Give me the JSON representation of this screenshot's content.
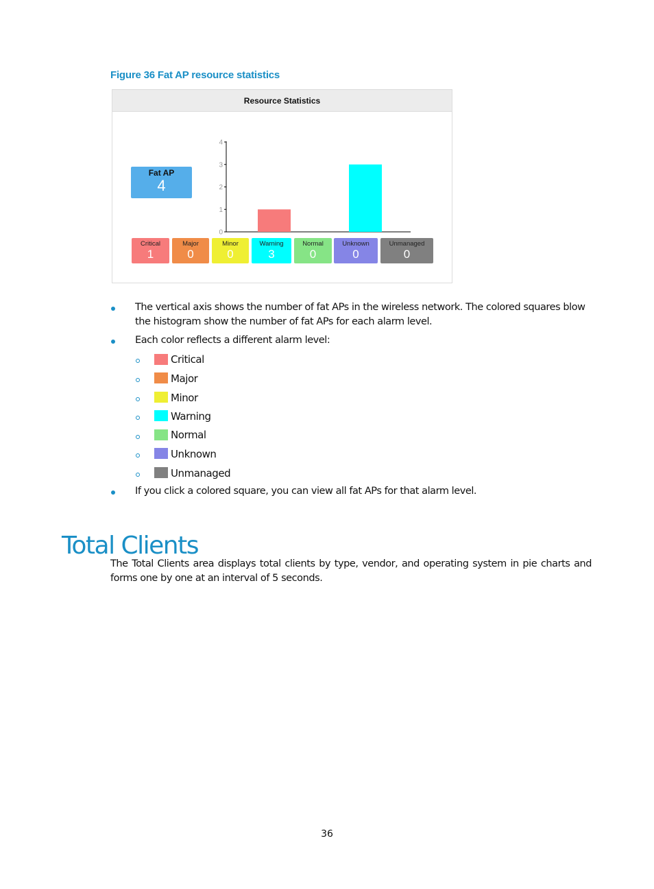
{
  "figure": {
    "caption": "Figure 36 Fat AP resource statistics",
    "panel_title": "Resource Statistics",
    "fat_ap": {
      "label": "Fat AP",
      "value": "4",
      "color": "#55aeea"
    },
    "levels": [
      {
        "name": "Critical",
        "value": "1",
        "color": "#f77b7b"
      },
      {
        "name": "Major",
        "value": "0",
        "color": "#f08c48"
      },
      {
        "name": "Minor",
        "value": "0",
        "color": "#efef33"
      },
      {
        "name": "Warning",
        "value": "3",
        "color": "#00ffff"
      },
      {
        "name": "Normal",
        "value": "0",
        "color": "#86e486"
      },
      {
        "name": "Unknown",
        "value": "0",
        "color": "#8585e6"
      },
      {
        "name": "Unmanaged",
        "value": "0",
        "color": "#808080"
      }
    ]
  },
  "chart_data": {
    "type": "bar",
    "title": "",
    "xlabel": "",
    "ylabel": "",
    "categories": [
      "Critical",
      "Warning"
    ],
    "values": [
      1,
      3
    ],
    "colors": [
      "#f77b7b",
      "#00ffff"
    ],
    "yticks": [
      "0",
      "1",
      "2",
      "3",
      "4"
    ],
    "ylim": [
      0,
      4
    ],
    "grid": false,
    "legend": "none"
  },
  "bullets": [
    "The vertical axis shows the number of fat APs in the wireless network. The colored squares blow the histogram show the number of fat APs for each alarm level.",
    "Each color reflects a different alarm level:",
    "If you click a colored square, you can view all fat APs for that alarm level."
  ],
  "alarm_levels": [
    "Critical",
    "Major",
    "Minor",
    "Warning",
    "Normal",
    "Unknown",
    "Unmanaged"
  ],
  "section": {
    "title": "Total Clients",
    "paragraph": "The Total Clients area displays total clients by type, vendor, and operating system in pie charts and forms one by one at an interval of 5 seconds."
  },
  "page_number": "36"
}
